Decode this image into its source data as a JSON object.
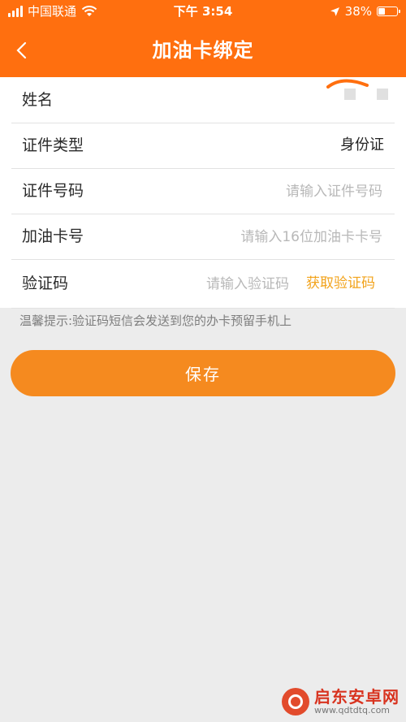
{
  "status_bar": {
    "carrier": "中国联通",
    "time": "下午 3:54",
    "battery_percent": "38%",
    "battery_level": 0.38
  },
  "nav": {
    "title": "加油卡绑定",
    "back_icon": "chevron-left-icon"
  },
  "form": {
    "name": {
      "label": "姓名"
    },
    "id_type": {
      "label": "证件类型",
      "value": "身份证"
    },
    "id_number": {
      "label": "证件号码",
      "placeholder": "请输入证件号码"
    },
    "card_number": {
      "label": "加油卡号",
      "placeholder": "请输入16位加油卡卡号"
    },
    "verify_code": {
      "label": "验证码",
      "placeholder": "请输入验证码",
      "get_code_label": "获取验证码"
    }
  },
  "hint": "温馨提示:验证码短信会发送到您的办卡预留手机上",
  "save_label": "保存",
  "watermark": {
    "title": "启东安卓网",
    "url": "www.qdtdtq.com"
  },
  "colors": {
    "header": "#ff6f0f",
    "save_button": "#f58a1f",
    "get_code_text": "#f2a31b",
    "background": "#ececec"
  }
}
